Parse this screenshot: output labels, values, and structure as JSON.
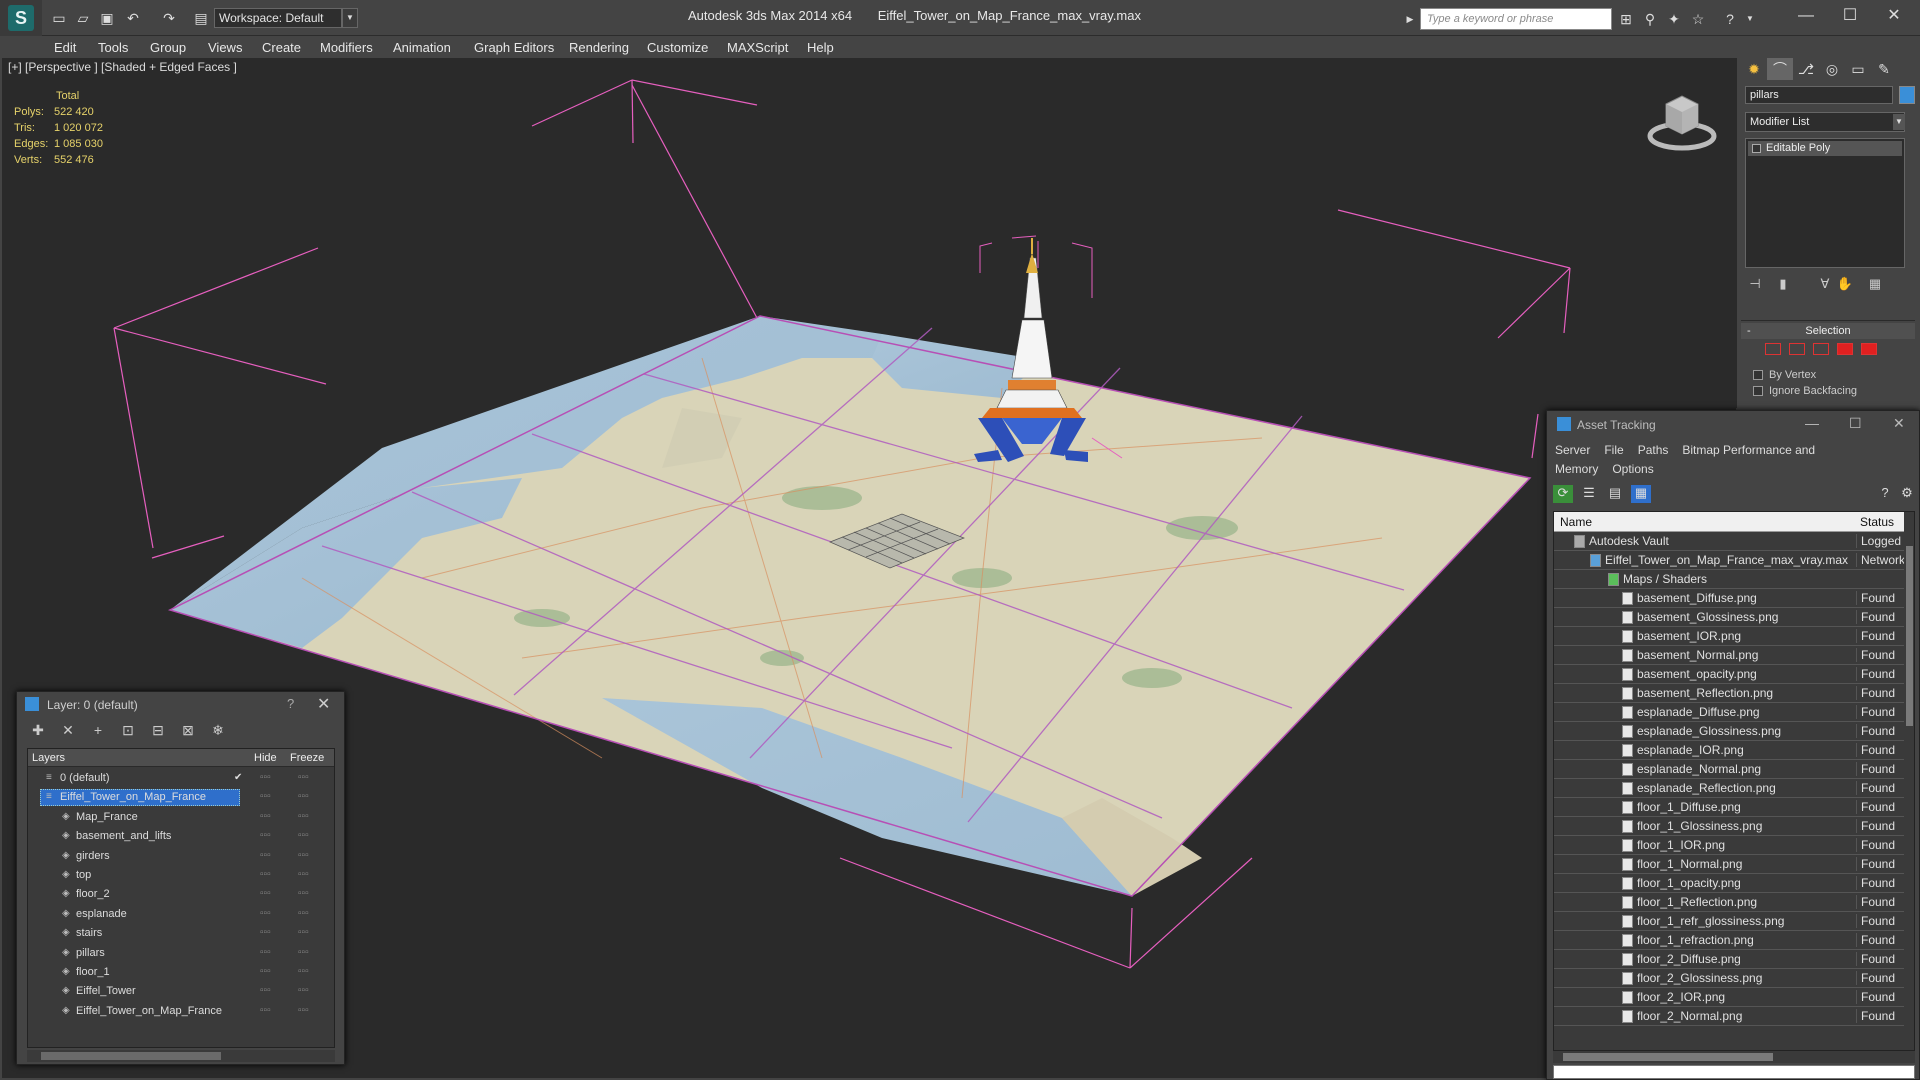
{
  "titlebar": {
    "workspace": "Workspace: Default",
    "app_title": "Autodesk 3ds Max  2014 x64",
    "file_title": "Eiffel_Tower_on_Map_France_max_vray.max",
    "search_placeholder": "Type a keyword or phrase",
    "minimize": "—",
    "maximize": "☐",
    "close": "✕"
  },
  "menu": [
    "Edit",
    "Tools",
    "Group",
    "Views",
    "Create",
    "Modifiers",
    "Animation",
    "Graph Editors",
    "Rendering",
    "Customize",
    "MAXScript",
    "Help"
  ],
  "viewport": {
    "label": "[+] [Perspective ] [Shaded + Edged Faces ]",
    "stats": {
      "header": "Total",
      "rows": [
        {
          "k": "Polys:",
          "v": "522 420"
        },
        {
          "k": "Tris:",
          "v": "1 020 072"
        },
        {
          "k": "Edges:",
          "v": "1 085 030"
        },
        {
          "k": "Verts:",
          "v": "552 476"
        }
      ]
    }
  },
  "command_panel": {
    "object_name": "pillars",
    "object_color": "#3a8fd8",
    "modifier_list": "Modifier List",
    "stack_item": "Editable Poly",
    "selection_title": "Selection",
    "by_vertex": "By Vertex",
    "ignore_backfacing": "Ignore Backfacing"
  },
  "layer_window": {
    "title": "Layer: 0 (default)",
    "help": "?",
    "close": "✕",
    "headers": {
      "layers": "Layers",
      "hide": "Hide",
      "freeze": "Freeze"
    },
    "rows": [
      {
        "name": "0 (default)",
        "level": 0,
        "current": true
      },
      {
        "name": "Eiffel_Tower_on_Map_France",
        "level": 0,
        "selected": true
      },
      {
        "name": "Map_France",
        "level": 1
      },
      {
        "name": "basement_and_lifts",
        "level": 1
      },
      {
        "name": "girders",
        "level": 1
      },
      {
        "name": "top",
        "level": 1
      },
      {
        "name": "floor_2",
        "level": 1
      },
      {
        "name": "esplanade",
        "level": 1
      },
      {
        "name": "stairs",
        "level": 1
      },
      {
        "name": "pillars",
        "level": 1
      },
      {
        "name": "floor_1",
        "level": 1
      },
      {
        "name": "Eiffel_Tower",
        "level": 1
      },
      {
        "name": "Eiffel_Tower_on_Map_France",
        "level": 1
      }
    ]
  },
  "asset_window": {
    "title": "Asset Tracking",
    "menu": [
      "Server",
      "File",
      "Paths",
      "Bitmap Performance and Memory",
      "Options"
    ],
    "headers": {
      "name": "Name",
      "status": "Status"
    },
    "rows": [
      {
        "name": "Autodesk Vault",
        "status": "Logged",
        "level": 0
      },
      {
        "name": "Eiffel_Tower_on_Map_France_max_vray.max",
        "status": "Network",
        "level": 1
      },
      {
        "name": "Maps / Shaders",
        "status": "",
        "level": 2
      },
      {
        "name": "basement_Diffuse.png",
        "status": "Found",
        "level": 3
      },
      {
        "name": "basement_Glossiness.png",
        "status": "Found",
        "level": 3
      },
      {
        "name": "basement_IOR.png",
        "status": "Found",
        "level": 3
      },
      {
        "name": "basement_Normal.png",
        "status": "Found",
        "level": 3
      },
      {
        "name": "basement_opacity.png",
        "status": "Found",
        "level": 3
      },
      {
        "name": "basement_Reflection.png",
        "status": "Found",
        "level": 3
      },
      {
        "name": "esplanade_Diffuse.png",
        "status": "Found",
        "level": 3
      },
      {
        "name": "esplanade_Glossiness.png",
        "status": "Found",
        "level": 3
      },
      {
        "name": "esplanade_IOR.png",
        "status": "Found",
        "level": 3
      },
      {
        "name": "esplanade_Normal.png",
        "status": "Found",
        "level": 3
      },
      {
        "name": "esplanade_Reflection.png",
        "status": "Found",
        "level": 3
      },
      {
        "name": "floor_1_Diffuse.png",
        "status": "Found",
        "level": 3
      },
      {
        "name": "floor_1_Glossiness.png",
        "status": "Found",
        "level": 3
      },
      {
        "name": "floor_1_IOR.png",
        "status": "Found",
        "level": 3
      },
      {
        "name": "floor_1_Normal.png",
        "status": "Found",
        "level": 3
      },
      {
        "name": "floor_1_opacity.png",
        "status": "Found",
        "level": 3
      },
      {
        "name": "floor_1_Reflection.png",
        "status": "Found",
        "level": 3
      },
      {
        "name": "floor_1_refr_glossiness.png",
        "status": "Found",
        "level": 3
      },
      {
        "name": "floor_1_refraction.png",
        "status": "Found",
        "level": 3
      },
      {
        "name": "floor_2_Diffuse.png",
        "status": "Found",
        "level": 3
      },
      {
        "name": "floor_2_Glossiness.png",
        "status": "Found",
        "level": 3
      },
      {
        "name": "floor_2_IOR.png",
        "status": "Found",
        "level": 3
      },
      {
        "name": "floor_2_Normal.png",
        "status": "Found",
        "level": 3
      }
    ]
  }
}
